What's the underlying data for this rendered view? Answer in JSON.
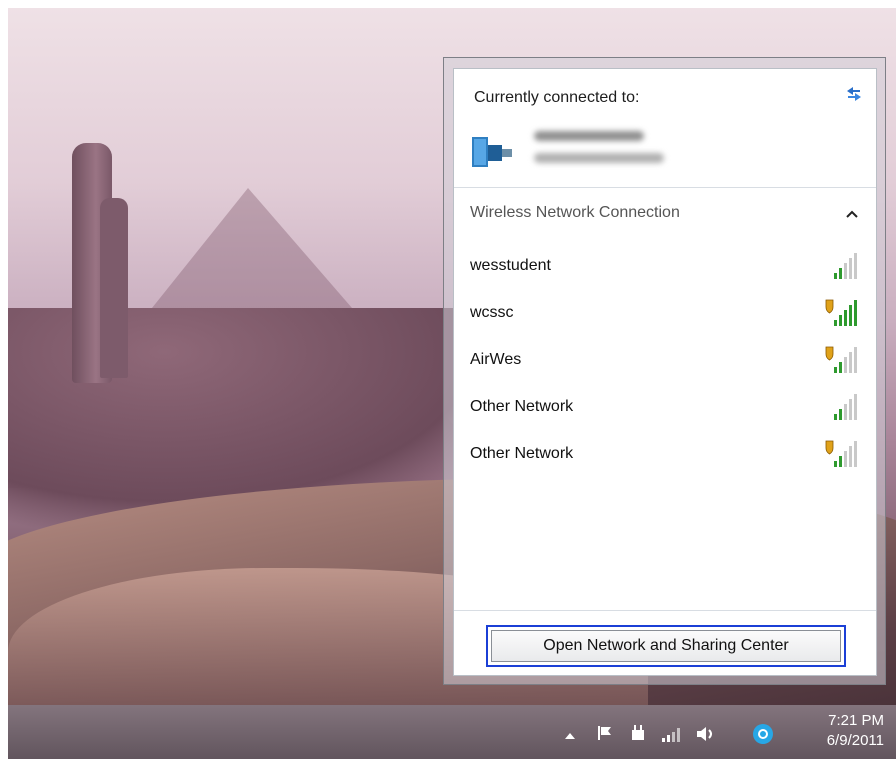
{
  "flyout": {
    "connected_heading": "Currently connected to:",
    "refresh_icon": "refresh-icon",
    "section_heading": "Wireless Network Connection",
    "collapse_glyph": "^",
    "networks": [
      {
        "name": "wesstudent",
        "secured": false,
        "bars_lit": 2
      },
      {
        "name": "wcssc",
        "secured": true,
        "bars_lit": 5
      },
      {
        "name": "AirWes",
        "secured": true,
        "bars_lit": 2
      },
      {
        "name": "Other Network",
        "secured": false,
        "bars_lit": 2
      },
      {
        "name": "Other Network",
        "secured": true,
        "bars_lit": 2
      }
    ],
    "footer_button": "Open Network and Sharing Center"
  },
  "taskbar": {
    "time": "7:21 PM",
    "date": "6/9/2011",
    "tray_icons": [
      "show-hidden-icons-arrow",
      "action-center-flag-icon",
      "power-plug-icon",
      "network-signal-icon",
      "volume-icon",
      "app-tray-icon"
    ]
  },
  "colors": {
    "accent_focus": "#1b3fd6",
    "signal_green": "#2e9a2e",
    "shield_gold": "#e0a21a"
  }
}
